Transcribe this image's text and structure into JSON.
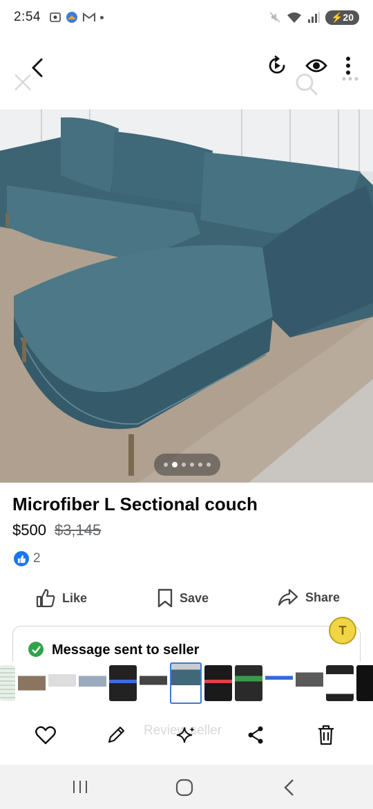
{
  "status_bar": {
    "time": "2:54",
    "battery": "20"
  },
  "listing": {
    "title": "Microfiber L Sectional couch",
    "price": "$500",
    "original_price": "$3,145",
    "like_count": "2"
  },
  "actions": {
    "like": "Like",
    "save": "Save",
    "share": "Share"
  },
  "message_card": {
    "text": "Message sent to seller"
  },
  "toolbar": {
    "ghost_label": "Review seller"
  },
  "photo_carousel": {
    "total": 6,
    "active_index": 1
  },
  "colors": {
    "accent_blue": "#1877f2",
    "check_green": "#31a24c",
    "sofa_teal": "#3f6877"
  },
  "icons": [
    "back-arrow-icon",
    "replay-icon",
    "eye-icon",
    "more-vertical-icon",
    "thumbs-up-icon",
    "bookmark-icon",
    "share-arrow-icon",
    "check-circle-icon",
    "heart-icon",
    "pencil-icon",
    "sparkle-icon",
    "share-nodes-icon",
    "trash-icon"
  ]
}
